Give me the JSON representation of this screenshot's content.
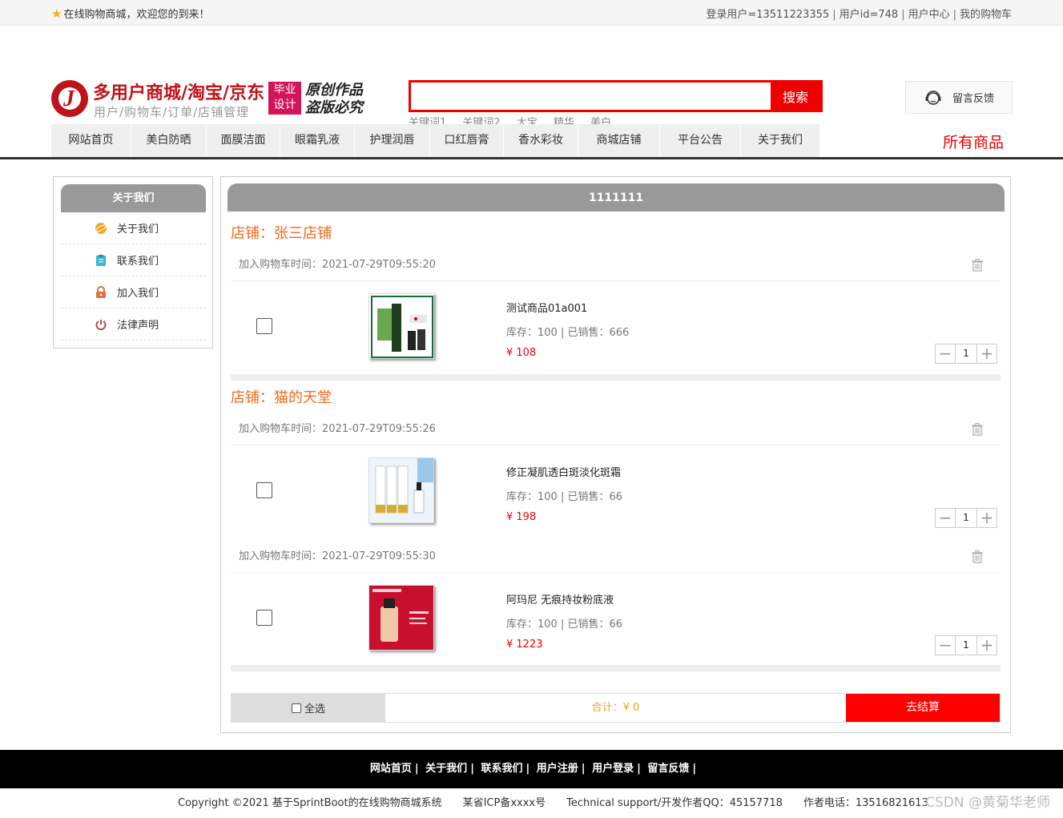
{
  "topbar": {
    "welcome": "在线购物商城，欢迎您的到来！",
    "login_user": "登录用户=13511223355",
    "user_id": "用户id=748",
    "user_center": "用户中心",
    "my_cart": "我的购物车"
  },
  "header": {
    "brand_title": "多用户商城/淘宝/京东",
    "brand_sub": "用户/购物车/订单/店铺管理",
    "badge_line1": "毕业",
    "badge_line2": "设计",
    "slogan_line1": "原创作品",
    "slogan_line2": "盗版必究",
    "search_button": "搜索",
    "search_placeholder": "",
    "keywords": [
      "关键词1",
      "关键词2",
      "大宝",
      "精华",
      "美白"
    ],
    "feedback": "留言反馈"
  },
  "nav": {
    "items": [
      "网站首页",
      "美白防晒",
      "面膜洁面",
      "眼霜乳液",
      "护理润唇",
      "口红唇膏",
      "香水彩妆",
      "商城店铺",
      "平台公告",
      "关于我们"
    ],
    "all_goods": "所有商品"
  },
  "sidebar": {
    "title": "关于我们",
    "items": [
      {
        "label": "关于我们",
        "icon": "planet-icon",
        "color": "#f5a623"
      },
      {
        "label": "联系我们",
        "icon": "clipboard-icon",
        "color": "#3bb4d8"
      },
      {
        "label": "加入我们",
        "icon": "lock-icon",
        "color": "#e0703a"
      },
      {
        "label": "法律声明",
        "icon": "power-icon",
        "color": "#b05040"
      }
    ]
  },
  "main": {
    "title": "1111111",
    "shops": [
      {
        "name": "店铺：张三店铺",
        "items": [
          {
            "time": "加入购物车时间：2021-07-29T09:55:20",
            "name": "测试商品01a001",
            "stock": "库存：100 | 已销售：666",
            "price": "¥ 108",
            "qty": "1"
          }
        ]
      },
      {
        "name": "店铺：猫的天堂",
        "items": [
          {
            "time": "加入购物车时间：2021-07-29T09:55:26",
            "name": "修正凝肌透白斑淡化斑霜",
            "stock": "库存：100 | 已销售：66",
            "price": "¥ 198",
            "qty": "1"
          },
          {
            "time": "加入购物车时间：2021-07-29T09:55:30",
            "name": "阿玛尼 无痕持妆粉底液",
            "stock": "库存：100 | 已销售：66",
            "price": "¥ 1223",
            "qty": "1"
          }
        ]
      }
    ],
    "select_all": "全选",
    "total": "合计：¥ 0",
    "checkout": "去结算"
  },
  "footer": {
    "links": [
      "网站首页",
      "关于我们",
      "联系我们",
      "用户注册",
      "用户登录",
      "留言反馈"
    ],
    "copyright": "Copyright ©2021 基于SprintBoot的在线购物商城系统　　某省ICP备xxxx号　　Technical support/开发作者QQ：45157718　　作者电话：13516821613",
    "watermark": "CSDN @黄菊华老师"
  }
}
